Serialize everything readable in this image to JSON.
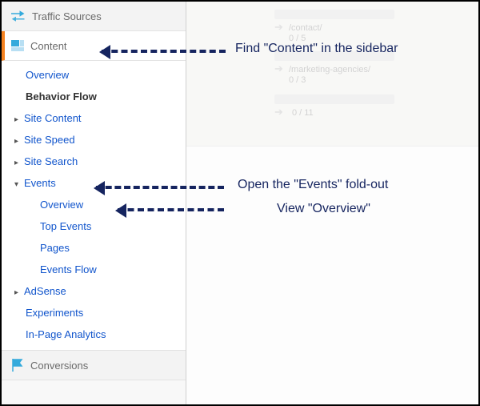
{
  "sidebar": {
    "traffic": {
      "label": "Traffic Sources"
    },
    "content": {
      "label": "Content",
      "overview": "Overview",
      "behavior_flow": "Behavior Flow",
      "site_content": "Site Content",
      "site_speed": "Site Speed",
      "site_search": "Site Search",
      "events": {
        "label": "Events",
        "overview": "Overview",
        "top_events": "Top Events",
        "pages": "Pages",
        "events_flow": "Events Flow"
      },
      "adsense": "AdSense",
      "experiments": "Experiments",
      "inpage": "In-Page Analytics"
    },
    "conversions": {
      "label": "Conversions"
    }
  },
  "flow": {
    "box1": {
      "path": "/contact/",
      "count": "0 / 5"
    },
    "box2": {
      "path": "/marketing-agencies/",
      "count": "0 / 3"
    },
    "box3": {
      "path": "",
      "count": "0 / 11"
    }
  },
  "annotations": {
    "a1": "Find \"Content\" in the sidebar",
    "a2": "Open the \"Events\" fold-out",
    "a3": "View \"Overview\""
  }
}
